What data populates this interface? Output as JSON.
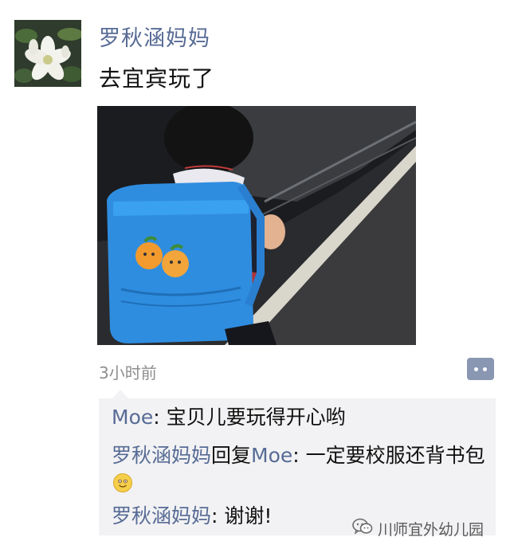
{
  "post": {
    "author": "罗秋涵妈妈",
    "text": "去宜宾玩了",
    "time": "3小时前",
    "photo_icon": "child-with-blue-backpack-photo"
  },
  "avatar_icon": "white-flower-avatar",
  "comments": [
    {
      "from": "Moe",
      "separator": ": ",
      "text": "宝贝儿要玩得开心哟"
    },
    {
      "from": "罗秋涵妈妈",
      "reply_word": "回复",
      "to": "Moe",
      "separator": ": ",
      "text": "一定要校服还背书包",
      "emoji": "smile-emoji"
    },
    {
      "from": "罗秋涵妈妈",
      "separator": ": ",
      "text": "谢谢!"
    }
  ],
  "watermark": {
    "text": "川师宜外幼儿园",
    "icon": "wechat-icon"
  },
  "colors": {
    "link": "#576b95",
    "comment_bg": "#f2f2f4",
    "backpack_blue": "#2f8de0"
  }
}
